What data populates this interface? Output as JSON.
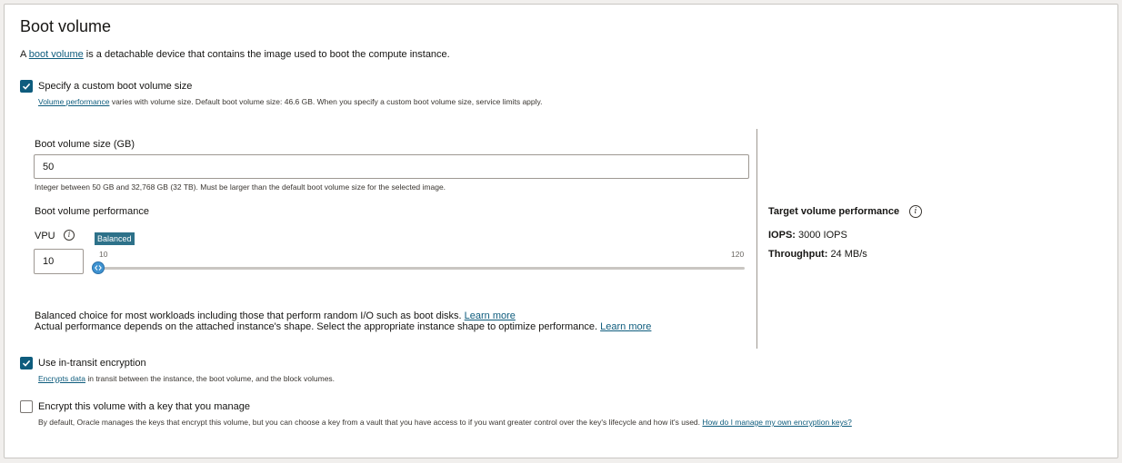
{
  "section": {
    "title": "Boot volume",
    "intro_prefix": "A",
    "intro_link": "boot volume",
    "intro_suffix": "is a detachable device that contains the image used to boot the compute instance."
  },
  "custom_size": {
    "checked": true,
    "label": "Specify a custom boot volume size",
    "helper_link": "Volume performance",
    "helper_text": "varies with volume size. Default boot volume size: 46.6 GB. When you specify a custom boot volume size, service limits apply."
  },
  "size_field": {
    "label": "Boot volume size (GB)",
    "value": "50",
    "helper": "Integer between 50 GB and 32,768 GB (32 TB). Must be larger than the default boot volume size for the selected image."
  },
  "performance": {
    "heading": "Boot volume performance",
    "vpu_label": "VPU",
    "vpu_value": "10",
    "badge": "Balanced",
    "slider_current": "10",
    "slider_max": "120",
    "slider": {
      "min": 10,
      "max": 120,
      "value": 10
    },
    "desc1": "Balanced choice for most workloads including those that perform random I/O such as boot disks.",
    "desc1_link": "Learn more",
    "desc2": "Actual performance depends on the attached instance's shape. Select the appropriate instance shape to optimize performance.",
    "desc2_link": "Learn more"
  },
  "target": {
    "heading": "Target volume performance",
    "iops_label": "IOPS:",
    "iops_value": "3000 IOPS",
    "throughput_label": "Throughput:",
    "throughput_value": "24 MB/s"
  },
  "in_transit": {
    "checked": true,
    "label": "Use in-transit encryption",
    "helper_link": "Encrypts data",
    "helper_text": "in transit between the instance, the boot volume, and the block volumes."
  },
  "own_key": {
    "checked": false,
    "label": "Encrypt this volume with a key that you manage",
    "helper_text": "By default, Oracle manages the keys that encrypt this volume, but you can choose a key from a vault that you have access to if you want greater control over the key's lifecycle and how it's used.",
    "helper_link": "How do I manage my own encryption keys?"
  },
  "colors": {
    "accent": "#0e5c7d",
    "badge": "#2d7189",
    "thumb": "#3f93d1"
  },
  "icons": {
    "check": "check-icon",
    "info": "info-icon",
    "slider_handle": "chevron-left-right-icon"
  }
}
